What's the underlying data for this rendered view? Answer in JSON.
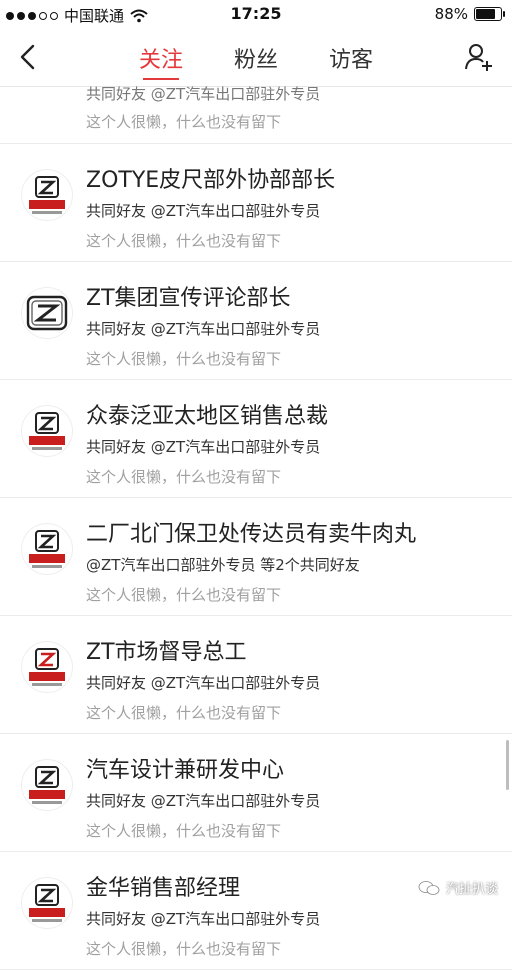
{
  "status_bar": {
    "carrier": "中国联通",
    "time": "17:25",
    "battery": "88%",
    "battery_level": 0.88
  },
  "nav": {
    "tabs": [
      {
        "label": "关注",
        "active": true
      },
      {
        "label": "粉丝",
        "active": false
      },
      {
        "label": "访客",
        "active": false
      }
    ]
  },
  "partial_item": {
    "mutual": "共同好友 @ZT汽车出口部驻外专员",
    "bio": "这个人很懒，什么也没有留下"
  },
  "items": [
    {
      "name": "ZOTYE皮尺部外协部部长",
      "mutual": "共同好友 @ZT汽车出口部驻外专员",
      "bio": "这个人很懒，什么也没有留下"
    },
    {
      "name": "ZT集团宣传评论部长",
      "mutual": "共同好友 @ZT汽车出口部驻外专员",
      "bio": "这个人很懒，什么也没有留下"
    },
    {
      "name": "众泰泛亚太地区销售总裁",
      "mutual": "共同好友 @ZT汽车出口部驻外专员",
      "bio": "这个人很懒，什么也没有留下"
    },
    {
      "name": "二厂北门保卫处传达员有卖牛肉丸",
      "mutual": "@ZT汽车出口部驻外专员 等2个共同好友",
      "bio": "这个人很懒，什么也没有留下"
    },
    {
      "name": "ZT市场督导总工",
      "mutual": "共同好友 @ZT汽车出口部驻外专员",
      "bio": "这个人很懒，什么也没有留下"
    },
    {
      "name": "汽车设计兼研发中心",
      "mutual": "共同好友 @ZT汽车出口部驻外专员",
      "bio": "这个人很懒，什么也没有留下"
    },
    {
      "name": "金华销售部经理",
      "mutual": "共同好友 @ZT汽车出口部驻外专员",
      "bio": "这个人很懒，什么也没有留下"
    }
  ],
  "watermark": "汽扯扒谈",
  "colors": {
    "accent": "#e4393c",
    "logo_red": "#c81e1e"
  }
}
